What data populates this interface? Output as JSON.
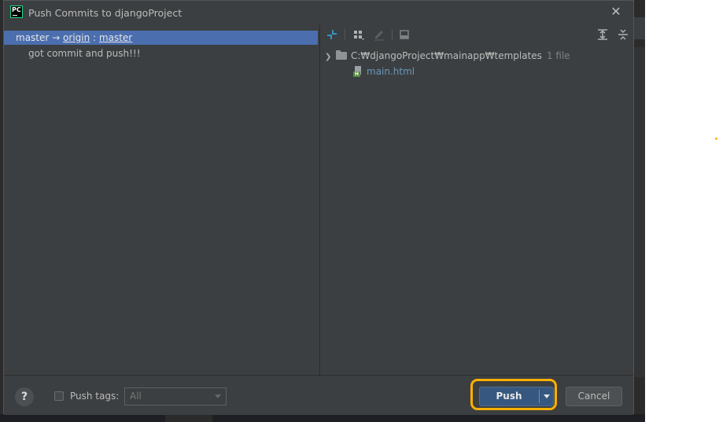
{
  "dialog": {
    "title": "Push Commits to djangoProject",
    "app_icon_text": "PC"
  },
  "commits_panel": {
    "branch_row": {
      "local": "master",
      "arrow": "→",
      "remote": "origin",
      "colon": ":",
      "remote_branch": "master"
    },
    "commit_message": "got commit and push!!!"
  },
  "changes_panel": {
    "toolbar_icons": [
      "show-diff-icon",
      "group-by-icon",
      "edit-source-icon",
      "shelve-icon",
      "expand-all-icon",
      "collapse-all-icon"
    ],
    "folder": {
      "path": "C:₩djangoProject₩mainapp₩templates",
      "count": "1 file"
    },
    "file": {
      "name": "main.html",
      "icon_letter": "H"
    }
  },
  "footer": {
    "help_label": "?",
    "push_tags_label": "Push tags:",
    "push_tags_checked": false,
    "tags_select_value": "All",
    "push_label": "Push",
    "cancel_label": "Cancel"
  },
  "colors": {
    "selection": "#4b6eaf",
    "file_link": "#6897bb",
    "annotation": "#ffb000",
    "push_button": "#365880"
  }
}
